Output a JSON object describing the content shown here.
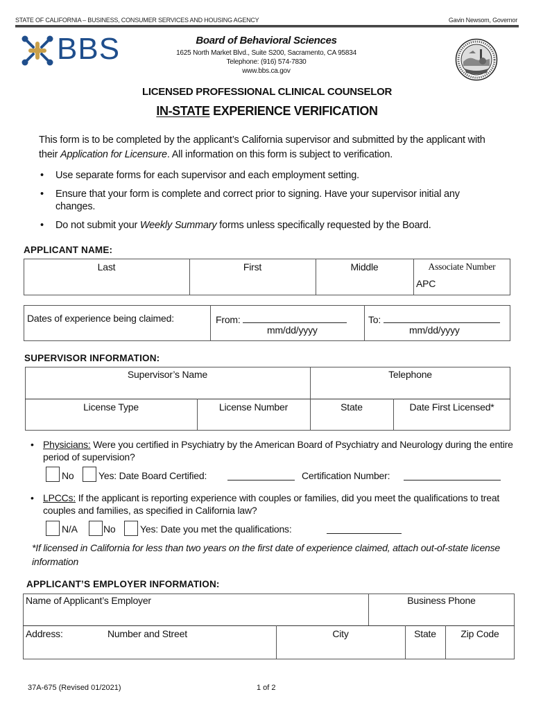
{
  "header": {
    "agency": "STATE OF CALIFORNIA – BUSINESS, CONSUMER SERVICES AND HOUSING AGENCY",
    "governor": "Gavin Newsom, Governor",
    "logo_text": "BBS",
    "board_name": "Board of Behavioral Sciences",
    "address": "1625 North Market Blvd., Suite S200, Sacramento, CA 95834",
    "telephone": "Telephone: (916) 574-7830",
    "website": "www.bbs.ca.gov",
    "seal_icon": "state-seal-icon",
    "colors": {
      "logo_blue": "#1f4e8c",
      "logo_gold": "#c9a04a"
    }
  },
  "title": {
    "line1": "LICENSED PROFESSIONAL CLINICAL COUNSELOR",
    "line2_underlined": "IN-STATE",
    "line2_rest": " EXPERIENCE VERIFICATION"
  },
  "intro": {
    "part1": "This form is to be completed by the applicant’s California supervisor and submitted by the applicant with their ",
    "italic": "Application for Licensure",
    "part2": ". All information on this form is subject to verification."
  },
  "bullets": [
    {
      "text": "Use separate forms for each supervisor and each employment setting."
    },
    {
      "text": "Ensure that your form is complete and correct prior to signing. Have your supervisor initial any changes."
    },
    {
      "pre": "Do not submit your ",
      "italic": "Weekly Summary",
      "post": " forms unless specifically requested by the Board."
    }
  ],
  "applicant_name": {
    "label": "APPLICANT NAME:",
    "last": "Last",
    "first": "First",
    "middle": "Middle",
    "associate_number": "Associate Number",
    "apc_prefix": "APC"
  },
  "dates": {
    "label": "Dates of experience being claimed:",
    "from": "From:",
    "to": "To:",
    "format": "mm/dd/yyyy"
  },
  "supervisor": {
    "label": "SUPERVISOR INFORMATION:",
    "name": "Supervisor’s Name",
    "telephone": "Telephone",
    "license_type": "License Type",
    "license_number": "License Number",
    "state": "State",
    "date_first_licensed": "Date First Licensed*"
  },
  "physicians": {
    "label": "Physicians:",
    "question": "  Were you certified in Psychiatry by the American Board of Psychiatry and Neurology during the entire period of supervision?",
    "no": "No",
    "yes": "Yes:  Date Board Certified:",
    "cert_number": "Certification Number:"
  },
  "lpccs": {
    "label": "LPCCs:",
    "question": "  If the applicant is reporting experience with couples or families, did you meet the qualifications to treat couples and families, as specified in California law?",
    "na": "N/A",
    "no": "No",
    "yes": "Yes:  Date you met the qualifications:"
  },
  "footnote": "*If licensed in California for less than two years on the first date of experience claimed, attach out-of-state license information",
  "employer": {
    "label": "APPLICANT’S EMPLOYER INFORMATION:",
    "name": "Name of Applicant’s Employer",
    "business_phone": "Business Phone",
    "address": "Address:",
    "street": "Number and Street",
    "city": "City",
    "state": "State",
    "zip": "Zip Code"
  },
  "footer": {
    "form_number": "37A-675 (Revised 01/2021)",
    "page": "1 of 2"
  }
}
